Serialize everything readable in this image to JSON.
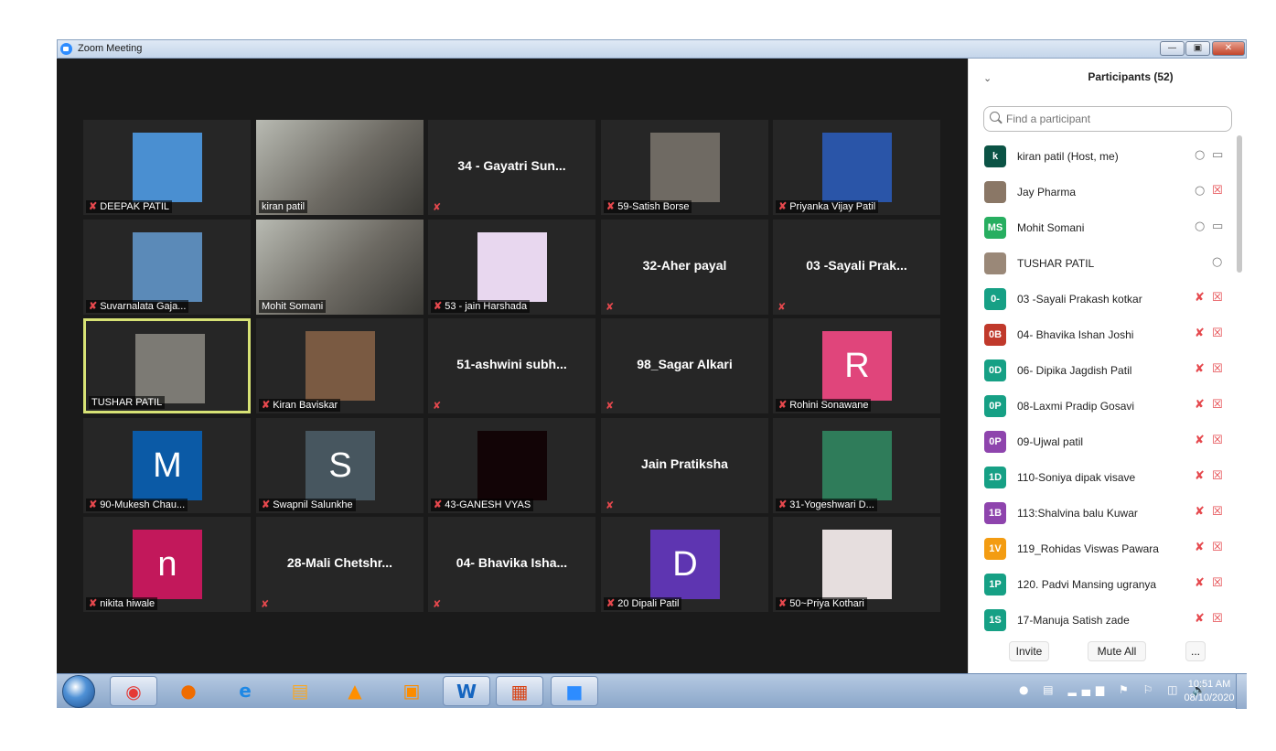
{
  "window": {
    "title": "Zoom Meeting"
  },
  "participants_panel": {
    "title": "Participants (52)",
    "search_placeholder": "Find a participant",
    "buttons": {
      "invite": "Invite",
      "mute_all": "Mute All",
      "more": "..."
    },
    "list": [
      {
        "initials": "k",
        "name": "kiran patil (Host, me)",
        "color": "#0b5345",
        "mic": "on",
        "cam": "on"
      },
      {
        "initials": "",
        "name": "Jay Pharma",
        "color": "#8a7766",
        "mic": "on",
        "cam": "off"
      },
      {
        "initials": "MS",
        "name": "Mohit Somani",
        "color": "#27ae60",
        "mic": "on",
        "cam": "on"
      },
      {
        "initials": "",
        "name": "TUSHAR PATIL",
        "color": "#9a8878",
        "mic": "active",
        "cam": "none"
      },
      {
        "initials": "0-",
        "name": "03 -Sayali  Prakash kotkar",
        "color": "#16a085",
        "mic": "off",
        "cam": "off"
      },
      {
        "initials": "0B",
        "name": "04- Bhavika Ishan Joshi",
        "color": "#c0392b",
        "mic": "off",
        "cam": "off"
      },
      {
        "initials": "0D",
        "name": "06- Dipika Jagdish Patil",
        "color": "#16a085",
        "mic": "off",
        "cam": "off"
      },
      {
        "initials": "0P",
        "name": "08-Laxmi Pradip Gosavi",
        "color": "#16a085",
        "mic": "off",
        "cam": "off"
      },
      {
        "initials": "0P",
        "name": "09-Ujwal  patil",
        "color": "#8e44ad",
        "mic": "off",
        "cam": "off"
      },
      {
        "initials": "1D",
        "name": "110-Soniya dipak visave",
        "color": "#16a085",
        "mic": "off",
        "cam": "off"
      },
      {
        "initials": "1B",
        "name": "113:Shalvina balu Kuwar",
        "color": "#8e44ad",
        "mic": "off",
        "cam": "off"
      },
      {
        "initials": "1V",
        "name": "119_Rohidas Viswas Pawara",
        "color": "#f39c12",
        "mic": "off",
        "cam": "off"
      },
      {
        "initials": "1P",
        "name": "120. Padvi Mansing ugranya",
        "color": "#16a085",
        "mic": "off",
        "cam": "off"
      },
      {
        "initials": "1S",
        "name": "17-Manuja Satish zade",
        "color": "#16a085",
        "mic": "off",
        "cam": "off"
      }
    ]
  },
  "gallery": {
    "tiles": [
      {
        "label": "DEEPAK PATIL",
        "kind": "photo",
        "muted": true,
        "photo_color": "#4a8fd1"
      },
      {
        "label": "kiran patil",
        "kind": "video",
        "muted": false
      },
      {
        "label": "",
        "center": "34 - Gayatri Sun...",
        "kind": "name",
        "muted": true
      },
      {
        "label": "59-Satish Borse",
        "kind": "photo",
        "muted": true,
        "photo_color": "#6f6a63"
      },
      {
        "label": "Priyanka Vijay Patil",
        "kind": "photo",
        "muted": true,
        "photo_color": "#2a55a8"
      },
      {
        "label": "Suvarnalata Gaja...",
        "kind": "photo",
        "muted": true,
        "photo_color": "#5b8ab8"
      },
      {
        "label": "Mohit Somani",
        "kind": "video",
        "muted": false
      },
      {
        "label": "53 - jain Harshada",
        "kind": "photo",
        "muted": true,
        "photo_color": "#e8d7ef"
      },
      {
        "label": "",
        "center": "32-Aher payal",
        "kind": "name",
        "muted": true
      },
      {
        "label": "",
        "center": "03 -Sayali  Prak...",
        "kind": "name",
        "muted": true
      },
      {
        "label": "TUSHAR PATIL",
        "kind": "photo",
        "muted": false,
        "active": true,
        "photo_color": "#7c7a74"
      },
      {
        "label": "Kiran Baviskar",
        "kind": "photo",
        "muted": true,
        "photo_color": "#7a5a42"
      },
      {
        "label": "",
        "center": "51-ashwini  subh...",
        "kind": "name",
        "muted": true
      },
      {
        "label": "",
        "center": "98_Sagar Alkari",
        "kind": "name",
        "muted": true
      },
      {
        "label": "Rohini Sonawane",
        "kind": "avatar",
        "letter": "R",
        "avatar_color": "#e0457b",
        "muted": true
      },
      {
        "label": "90-Mukesh Chau...",
        "kind": "avatar",
        "letter": "M",
        "avatar_color": "#0b5aa6",
        "muted": true
      },
      {
        "label": "Swapnil Salunkhe",
        "kind": "avatar",
        "letter": "S",
        "avatar_color": "#47565f",
        "muted": true
      },
      {
        "label": "43-GANESH VYAS",
        "kind": "photo",
        "muted": true,
        "photo_color": "#120406"
      },
      {
        "label": "",
        "center": "Jain Pratiksha",
        "kind": "name",
        "muted": true
      },
      {
        "label": "31-Yogeshwari D...",
        "kind": "photo",
        "muted": true,
        "photo_color": "#2f7c5a"
      },
      {
        "label": "nikita hiwale",
        "kind": "avatar",
        "letter": "n",
        "avatar_color": "#c2185b",
        "muted": true
      },
      {
        "label": "",
        "center": "28-Mali  Chetshr...",
        "kind": "name",
        "muted": true
      },
      {
        "label": "",
        "center": "04- Bhavika Isha...",
        "kind": "name",
        "muted": true
      },
      {
        "label": "20 Dipali Patil",
        "kind": "avatar",
        "letter": "D",
        "avatar_color": "#5e35b1",
        "muted": true
      },
      {
        "label": "50~Priya Kothari",
        "kind": "photo",
        "muted": true,
        "photo_color": "#e6dede"
      }
    ]
  },
  "taskbar": {
    "apps": [
      "chrome-icon",
      "firefox-icon",
      "ie-icon",
      "explorer-icon",
      "vlc-icon",
      "media-icon",
      "word-icon",
      "presentation-icon",
      "zoom-icon"
    ],
    "clock": {
      "time": "10:51 AM",
      "date": "08/10/2020"
    }
  }
}
